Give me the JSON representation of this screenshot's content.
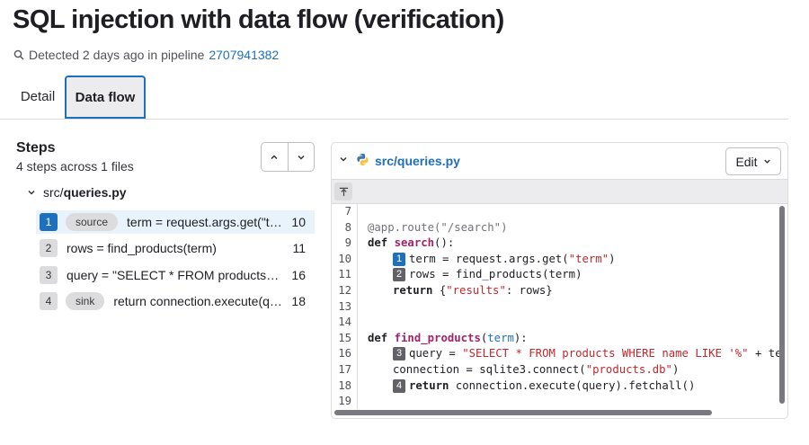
{
  "title": "SQL injection with data flow (verification)",
  "meta": {
    "icon": "search-icon",
    "detected_text": "Detected 2 days ago in pipeline",
    "pipeline_link": "2707941382"
  },
  "tabs": [
    {
      "label": "Detail",
      "selected": false
    },
    {
      "label": "Data flow",
      "selected": true
    }
  ],
  "steps_panel": {
    "title": "Steps",
    "subtitle": "4 steps across 1 files",
    "nav_icons": [
      "chevron-up-icon",
      "chevron-down-icon"
    ],
    "file_dir": "src/",
    "file_name": "queries.py",
    "steps": [
      {
        "num": "1",
        "badge": "source",
        "code": "term = request.args.get(\"term\")",
        "line": "10",
        "active": true
      },
      {
        "num": "2",
        "badge": "",
        "code": "rows = find_products(term)",
        "line": "11",
        "active": false
      },
      {
        "num": "3",
        "badge": "",
        "code": "query = \"SELECT * FROM products WHERE name LIKE '%\" + term + \"%'\"",
        "line": "16",
        "active": false
      },
      {
        "num": "4",
        "badge": "sink",
        "code": "return connection.execute(query).fetchall()",
        "line": "18",
        "active": false
      }
    ]
  },
  "viewer": {
    "file_path": "src/queries.py",
    "file_icon": "python-icon",
    "edit_label": "Edit",
    "line_numbers": [
      "7",
      "8",
      "9",
      "10",
      "11",
      "12",
      "13",
      "14",
      "15",
      "16",
      "17",
      "18",
      "19"
    ],
    "lines": {
      "l8": "@app.route(\"/search\")",
      "l9_kw": "def ",
      "l9_fn": "search",
      "l9_rest": "():",
      "l10_a": "term = request.args.get(",
      "l10_s": "\"term\"",
      "l10_b": ")",
      "l11": "rows = find_products(term)",
      "l12_kw": "return ",
      "l12_a": "{",
      "l12_s": "\"results\"",
      "l12_b": ": rows}",
      "l15_kw": "def ",
      "l15_fn": "find_products",
      "l15_a": "(",
      "l15_p": "term",
      "l15_b": "):",
      "l16_a": "query = ",
      "l16_s": "\"SELECT * FROM products WHERE name LIKE '%\"",
      "l16_b": " + te",
      "l17_a": "connection = sqlite3.connect(",
      "l17_s": "\"products.db\"",
      "l17_b": ")",
      "l18_kw": "return ",
      "l18_a": "connection.execute(query).fetchall()"
    },
    "markers": [
      "1",
      "2",
      "3",
      "4"
    ]
  }
}
